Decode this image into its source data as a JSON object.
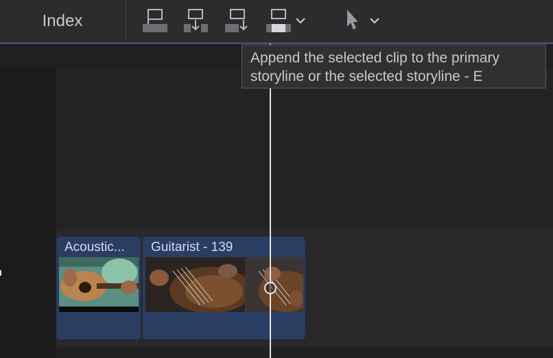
{
  "toolbar": {
    "index_label": "Index",
    "tools": [
      {
        "icon": "connect-clip-icon"
      },
      {
        "icon": "insert-clip-icon"
      },
      {
        "icon": "append-clip-icon"
      },
      {
        "icon": "overwrite-clip-icon"
      }
    ],
    "edit_dropdown_icon": "chevron-down-icon",
    "select_tool_icon": "arrow-pointer-icon"
  },
  "tooltip": {
    "line1": "Append the selected clip to the primary",
    "line2": "storyline or the selected storyline - E"
  },
  "timeline": {
    "clips": [
      {
        "title": "Acoustic..."
      },
      {
        "title": "Guitarist - 139"
      }
    ]
  },
  "colors": {
    "clip_fill": "#2a3d63",
    "accent_line": "#4b5a8c",
    "playhead": "#e8e8e8"
  }
}
